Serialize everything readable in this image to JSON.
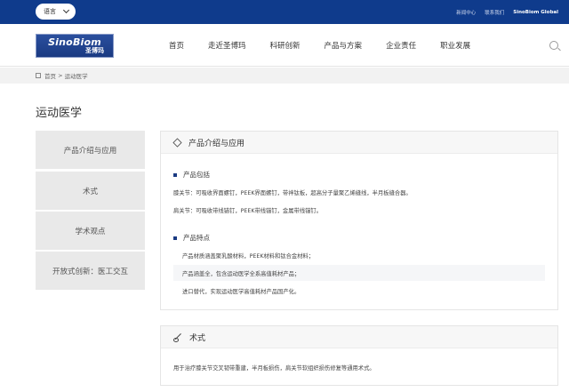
{
  "topbar": {
    "language_label": "语言",
    "links": [
      "新闻中心",
      "联系我们",
      "SinoBiom Global"
    ]
  },
  "header": {
    "logo_en": "SinoBiom",
    "logo_cn": "圣博玛",
    "nav": [
      "首页",
      "走近圣博玛",
      "科研创新",
      "产品与方案",
      "企业责任",
      "职业发展"
    ]
  },
  "breadcrumb": [
    "首页",
    "运动医学"
  ],
  "page_title": "运动医学",
  "sidebar": [
    "产品介绍与应用",
    "术式",
    "学术观点",
    "开放式创新：医工交互"
  ],
  "panel1": {
    "title": "产品介绍与应用",
    "section1_title": "产品包括",
    "section1_lines": [
      "膝关节：可吸收界面螺钉，PEEK界面螺钉，带袢钛板，超高分子量聚乙烯缝线，半月板缝合器。",
      "肩关节：可吸收带线锚钉，PEEK带线锚钉，金属带线锚钉。"
    ],
    "section2_title": "产品特点",
    "section2_lines": [
      "产品材质涵盖聚乳酸材料，PEEK材料和钛合金材料；",
      "产品涵盖全，包含运动医学全系高值耗材产品；",
      "进口替代，实现运动医学高值耗材产品国产化。"
    ]
  },
  "panel2": {
    "title": "术式",
    "text": "用于治疗膝关节交叉韧带重建，半月板损伤，肩关节软组织损伤修复等通用术式。"
  },
  "colors": {
    "topbar": "#0f3b8c",
    "accent": "#1a3a82"
  },
  "icons": [
    "chevron-down-icon",
    "search-icon",
    "home-icon",
    "layers-icon",
    "wrench-icon"
  ]
}
